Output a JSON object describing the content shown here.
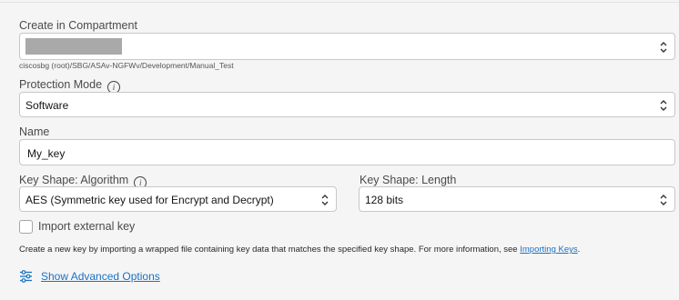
{
  "compartment": {
    "label": "Create in Compartment",
    "value": "",
    "path_hint": "ciscosbg (root)/SBG/ASAv-NGFWv/Development/Manual_Test"
  },
  "protection_mode": {
    "label": "Protection Mode",
    "value": "Software",
    "info_icon": "info-icon"
  },
  "name": {
    "label": "Name",
    "value": "My_key"
  },
  "key_shape_algorithm": {
    "label": "Key Shape: Algorithm",
    "value": "AES (Symmetric key used for Encrypt and Decrypt)",
    "info_icon": "info-icon"
  },
  "key_shape_length": {
    "label": "Key Shape: Length",
    "value": "128 bits"
  },
  "import_external": {
    "label": "Import external key",
    "checked": false
  },
  "description": {
    "text": "Create a new key by importing a wrapped file containing key data that matches the specified key shape. For more information, see ",
    "link_text": "Importing Keys",
    "suffix": "."
  },
  "advanced": {
    "label": "Show Advanced Options",
    "icon": "sliders-icon"
  },
  "colors": {
    "link": "#1a72c4",
    "border": "#c8c8c8",
    "background": "#f5f5f5"
  }
}
